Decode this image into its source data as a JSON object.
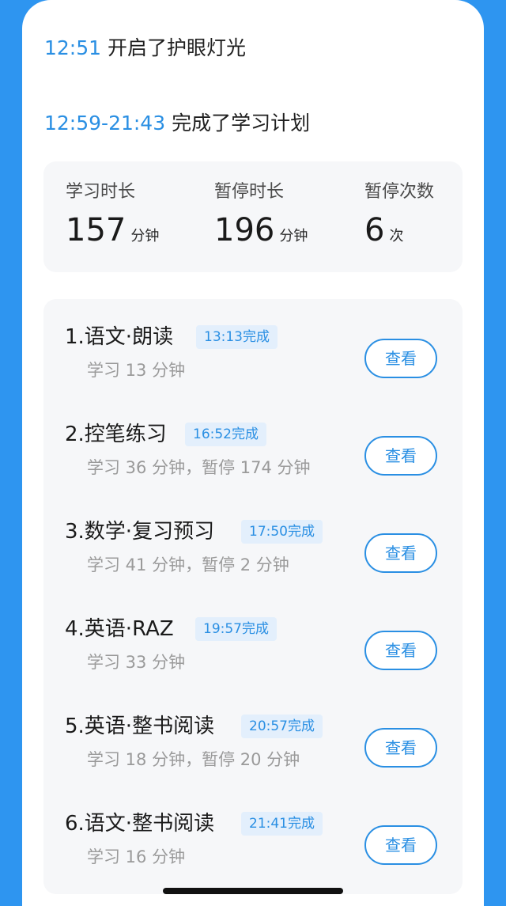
{
  "log": [
    {
      "time": "12:51",
      "text": "开启了护眼灯光"
    },
    {
      "time": "12:59-21:43",
      "text": "完成了学习计划"
    }
  ],
  "stats": [
    {
      "label": "学习时长",
      "value": "157",
      "unit": "分钟"
    },
    {
      "label": "暂停时长",
      "value": "196",
      "unit": "分钟"
    },
    {
      "label": "暂停次数",
      "value": "6",
      "unit": "次"
    }
  ],
  "tasks": [
    {
      "title": "1.语文·朗读",
      "badge": "13:13完成",
      "sub": "学习 13 分钟",
      "button": "查看"
    },
    {
      "title": "2.控笔练习",
      "badge": "16:52完成",
      "sub": "学习 36 分钟，暂停 174 分钟",
      "button": "查看"
    },
    {
      "title": "3.数学·复习预习",
      "badge": "17:50完成",
      "sub": "学习 41 分钟，暂停 2 分钟",
      "button": "查看"
    },
    {
      "title": "4.英语·RAZ",
      "badge": "19:57完成",
      "sub": "学习 33 分钟",
      "button": "查看"
    },
    {
      "title": "5.英语·整书阅读",
      "badge": "20:57完成",
      "sub": "学习 18 分钟，暂停 20 分钟",
      "button": "查看"
    },
    {
      "title": "6.语文·整书阅读",
      "badge": "21:41完成",
      "sub": "学习 16 分钟",
      "button": "查看"
    }
  ],
  "colors": {
    "accent": "#2a8fe3",
    "badge_bg": "#e3effc",
    "panel_bg": "#f6f7f9",
    "header_bg": "#2e95f0"
  }
}
